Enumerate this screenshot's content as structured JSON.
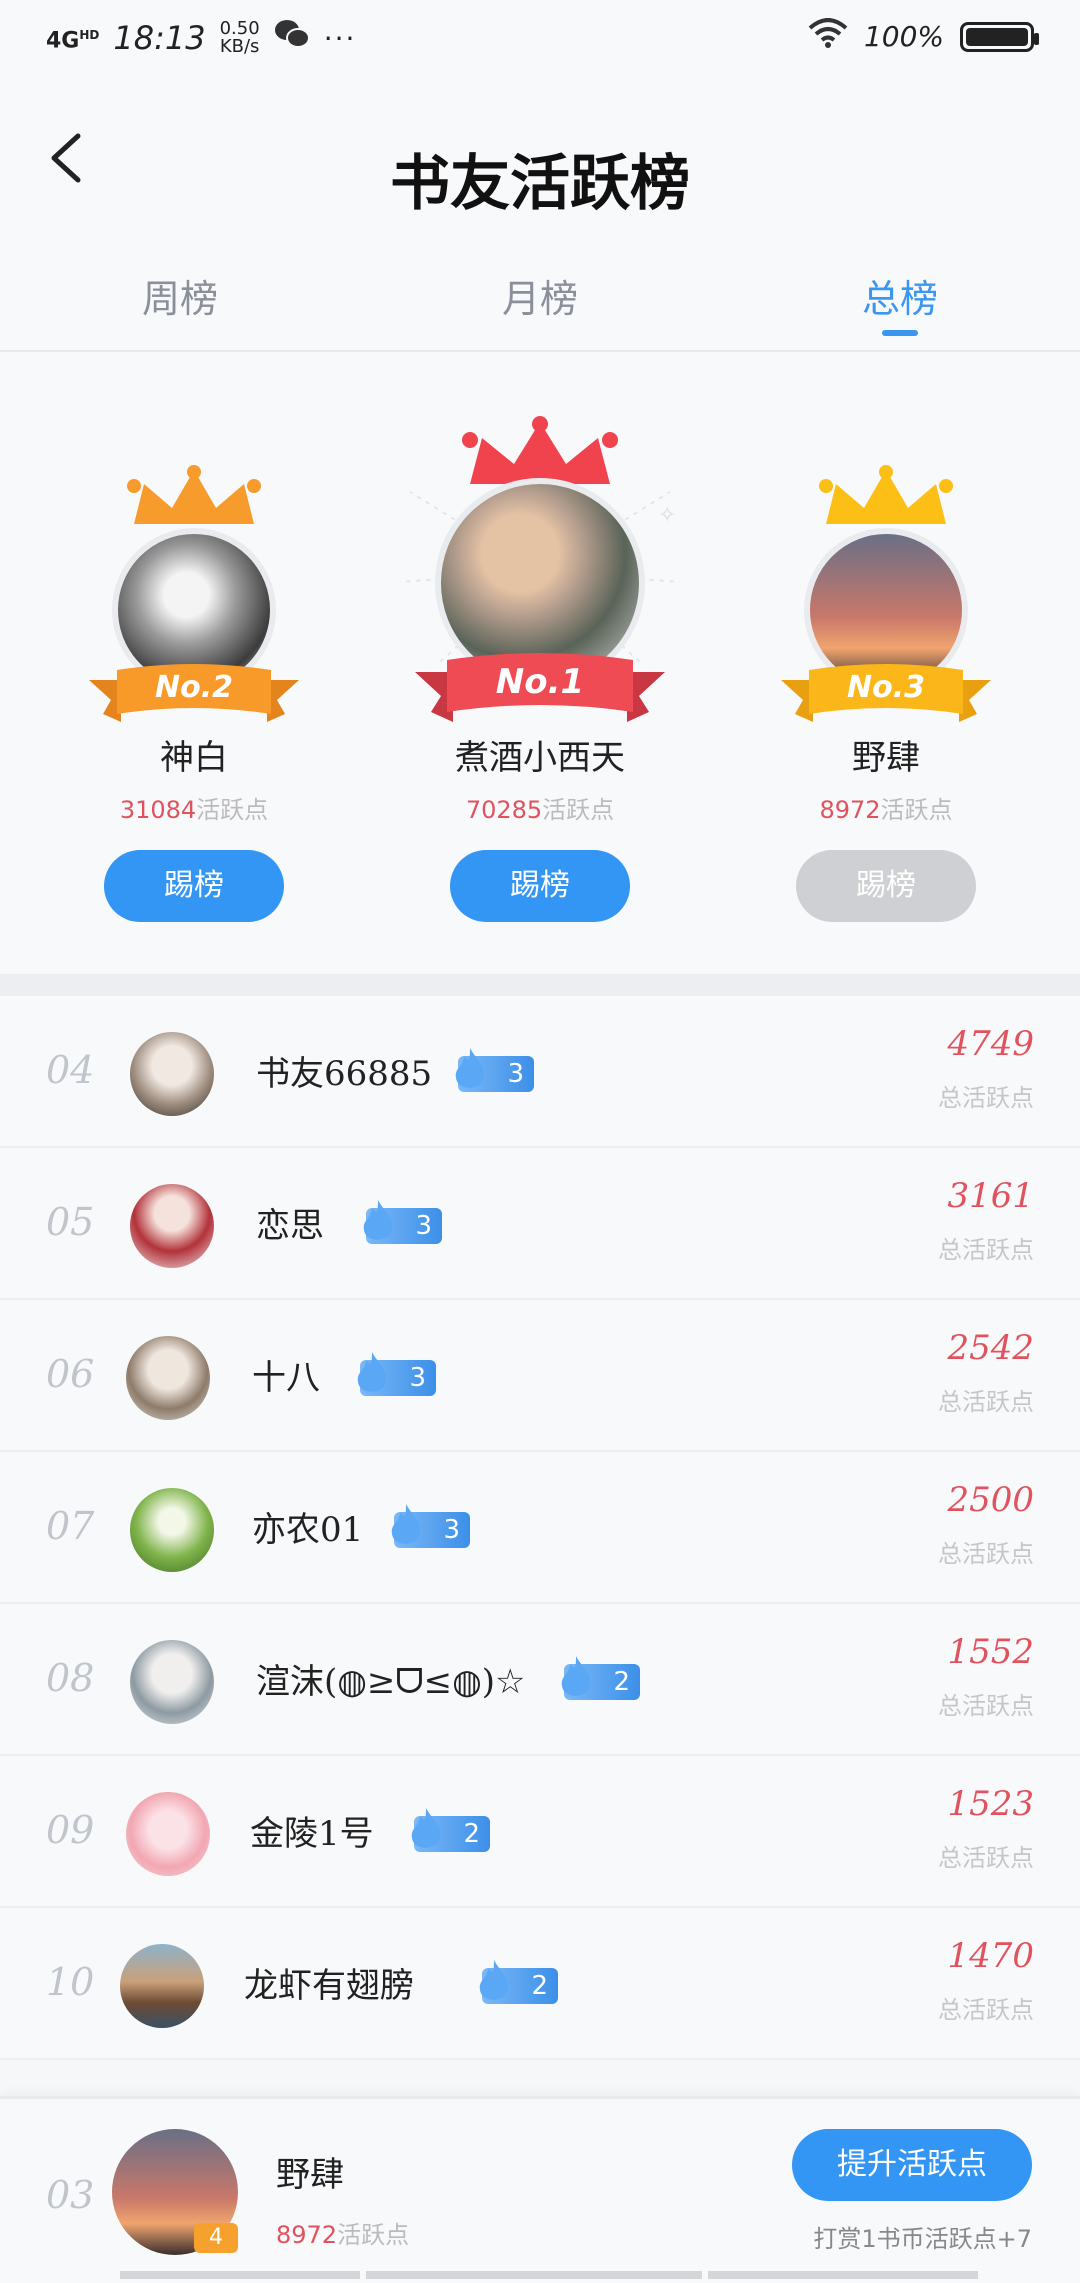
{
  "status_bar": {
    "network": "4G",
    "network_sup": "HD",
    "time": "18:13",
    "speed_value": "0.50",
    "speed_unit": "KB/s",
    "more": "···",
    "battery_text": "100%"
  },
  "header": {
    "title": "书友活跃榜"
  },
  "tabs": [
    {
      "label": "周榜",
      "active": false
    },
    {
      "label": "月榜",
      "active": false
    },
    {
      "label": "总榜",
      "active": true
    }
  ],
  "podium": [
    {
      "rank_label": "No.1",
      "name": "煮酒小西天",
      "points": "70285",
      "points_suffix": "活跃点",
      "button": "踢榜",
      "button_enabled": true,
      "crown_color": "#f0434d",
      "ribbon_color": "#ef4b54"
    },
    {
      "rank_label": "No.2",
      "name": "神白",
      "points": "31084",
      "points_suffix": "活跃点",
      "button": "踢榜",
      "button_enabled": true,
      "crown_color": "#f79b2c",
      "ribbon_color": "#f89a2a"
    },
    {
      "rank_label": "No.3",
      "name": "野肆",
      "points": "8972",
      "points_suffix": "活跃点",
      "button": "踢榜",
      "button_enabled": false,
      "crown_color": "#fbbf16",
      "ribbon_color": "#fbb619"
    }
  ],
  "list": [
    {
      "rank": "04",
      "name": "书友66885",
      "level": "3",
      "score": "4749",
      "score_label": "总活跃点"
    },
    {
      "rank": "05",
      "name": "恋思",
      "level": "3",
      "score": "3161",
      "score_label": "总活跃点"
    },
    {
      "rank": "06",
      "name": "十八",
      "level": "3",
      "score": "2542",
      "score_label": "总活跃点"
    },
    {
      "rank": "07",
      "name": "亦农01",
      "level": "3",
      "score": "2500",
      "score_label": "总活跃点"
    },
    {
      "rank": "08",
      "name": "渲沫(◍≥ᗜ≤◍)☆",
      "level": "2",
      "score": "1552",
      "score_label": "总活跃点"
    },
    {
      "rank": "09",
      "name": "金陵1号",
      "level": "2",
      "score": "1523",
      "score_label": "总活跃点"
    },
    {
      "rank": "10",
      "name": "龙虾有翅膀",
      "level": "2",
      "score": "1470",
      "score_label": "总活跃点"
    }
  ],
  "my_rank": {
    "rank": "03",
    "name": "野肆",
    "level": "4",
    "points": "8972",
    "points_suffix": "活跃点",
    "button": "提升活跃点",
    "tip": "打赏1书币活跃点+7"
  },
  "colors": {
    "accent": "#3396f4",
    "score_red": "#e0535e"
  }
}
